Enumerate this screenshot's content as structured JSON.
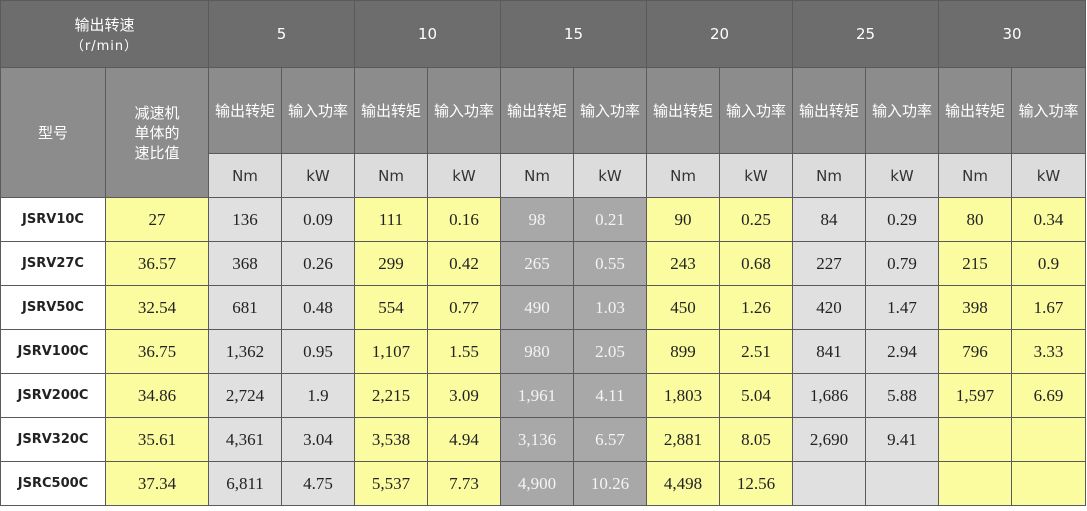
{
  "header": {
    "speed_title": "输出转速",
    "speed_unit": "（r/min）",
    "model_label": "型号",
    "ratio_label": [
      "减速机",
      "单体的",
      "速比值"
    ],
    "speeds": [
      "5",
      "10",
      "15",
      "20",
      "25",
      "30"
    ],
    "torque_label": "输出转矩",
    "power_label": "输入功率",
    "torque_unit": "Nm",
    "power_unit": "kW"
  },
  "colors": {
    "header_dark": "#6d6d6d",
    "header_mid": "#8c8c8c",
    "header_light": "#dcdcdc",
    "yellow": "#fbfba0",
    "light_gray": "#e0e0e0",
    "dark_gray_cell": "#a8a8a8",
    "white": "#ffffff"
  },
  "rows": [
    {
      "model": "JSRV10C",
      "ratio": "27",
      "values": [
        [
          "136",
          "0.09"
        ],
        [
          "111",
          "0.16"
        ],
        [
          "98",
          "0.21"
        ],
        [
          "90",
          "0.25"
        ],
        [
          "84",
          "0.29"
        ],
        [
          "80",
          "0.34"
        ]
      ]
    },
    {
      "model": "JSRV27C",
      "ratio": "36.57",
      "values": [
        [
          "368",
          "0.26"
        ],
        [
          "299",
          "0.42"
        ],
        [
          "265",
          "0.55"
        ],
        [
          "243",
          "0.68"
        ],
        [
          "227",
          "0.79"
        ],
        [
          "215",
          "0.9"
        ]
      ]
    },
    {
      "model": "JSRV50C",
      "ratio": "32.54",
      "values": [
        [
          "681",
          "0.48"
        ],
        [
          "554",
          "0.77"
        ],
        [
          "490",
          "1.03"
        ],
        [
          "450",
          "1.26"
        ],
        [
          "420",
          "1.47"
        ],
        [
          "398",
          "1.67"
        ]
      ]
    },
    {
      "model": "JSRV100C",
      "ratio": "36.75",
      "values": [
        [
          "1,362",
          "0.95"
        ],
        [
          "1,107",
          "1.55"
        ],
        [
          "980",
          "2.05"
        ],
        [
          "899",
          "2.51"
        ],
        [
          "841",
          "2.94"
        ],
        [
          "796",
          "3.33"
        ]
      ]
    },
    {
      "model": "JSRV200C",
      "ratio": "34.86",
      "values": [
        [
          "2,724",
          "1.9"
        ],
        [
          "2,215",
          "3.09"
        ],
        [
          "1,961",
          "4.11"
        ],
        [
          "1,803",
          "5.04"
        ],
        [
          "1,686",
          "5.88"
        ],
        [
          "1,597",
          "6.69"
        ]
      ]
    },
    {
      "model": "JSRV320C",
      "ratio": "35.61",
      "values": [
        [
          "4,361",
          "3.04"
        ],
        [
          "3,538",
          "4.94"
        ],
        [
          "3,136",
          "6.57"
        ],
        [
          "2,881",
          "8.05"
        ],
        [
          "2,690",
          "9.41"
        ],
        [
          "",
          ""
        ]
      ]
    },
    {
      "model": "JSRC500C",
      "ratio": "37.34",
      "values": [
        [
          "6,811",
          "4.75"
        ],
        [
          "5,537",
          "7.73"
        ],
        [
          "4,900",
          "10.26"
        ],
        [
          "4,498",
          "12.56"
        ],
        [
          "",
          ""
        ],
        [
          "",
          ""
        ]
      ]
    }
  ]
}
